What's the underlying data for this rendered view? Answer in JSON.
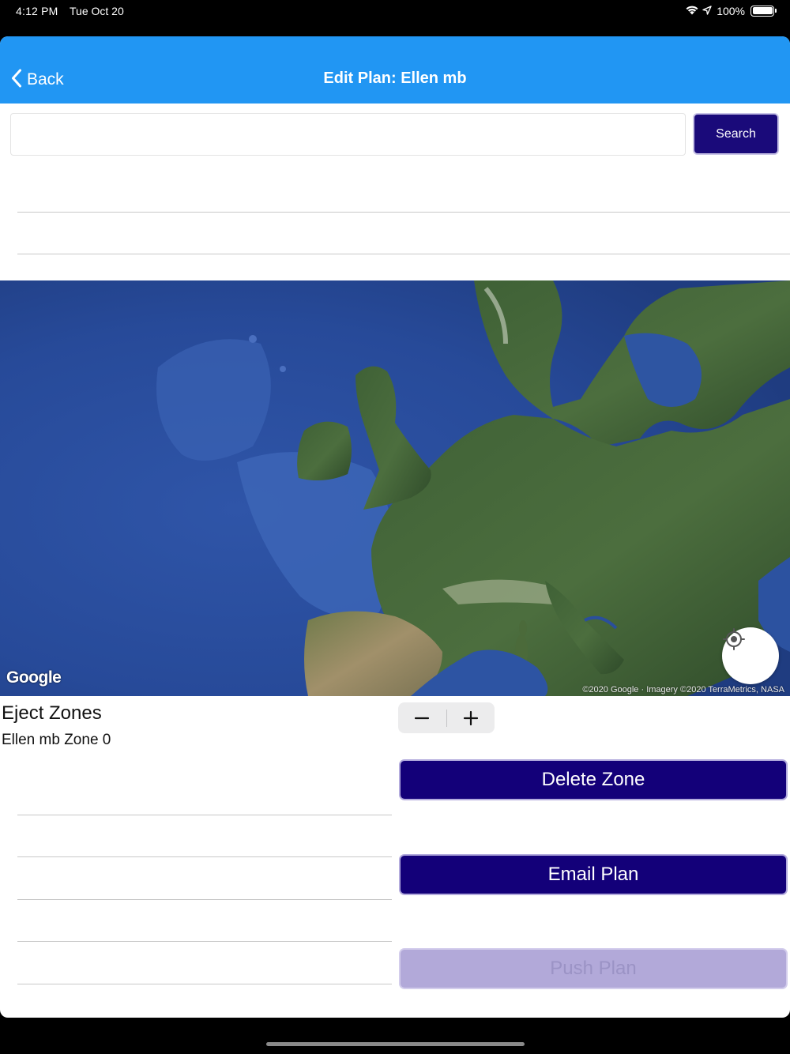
{
  "status_bar": {
    "time": "4:12 PM",
    "date": "Tue Oct 20",
    "battery_text": "100%",
    "icons": [
      "wifi-icon",
      "location-arrow-icon",
      "battery-icon"
    ]
  },
  "nav": {
    "back_label": "Back",
    "title": "Edit Plan: Ellen mb",
    "bar_color": "#2196F3"
  },
  "search": {
    "value": "",
    "placeholder": "",
    "button_label": "Search"
  },
  "map": {
    "type": "satellite",
    "region": "Europe",
    "logo_text": "Google",
    "attribution": "©2020 Google · Imagery ©2020 TerraMetrics, NASA"
  },
  "zones": {
    "title": "Eject Zones",
    "items": [
      "Ellen mb Zone 0"
    ]
  },
  "stepper": {
    "minus_label": "−",
    "plus_label": "+"
  },
  "actions": {
    "delete_zone": "Delete Zone",
    "email_plan": "Email Plan",
    "push_plan": "Push Plan",
    "primary_color": "#130079",
    "disabled_color": "#B2A9D9"
  }
}
